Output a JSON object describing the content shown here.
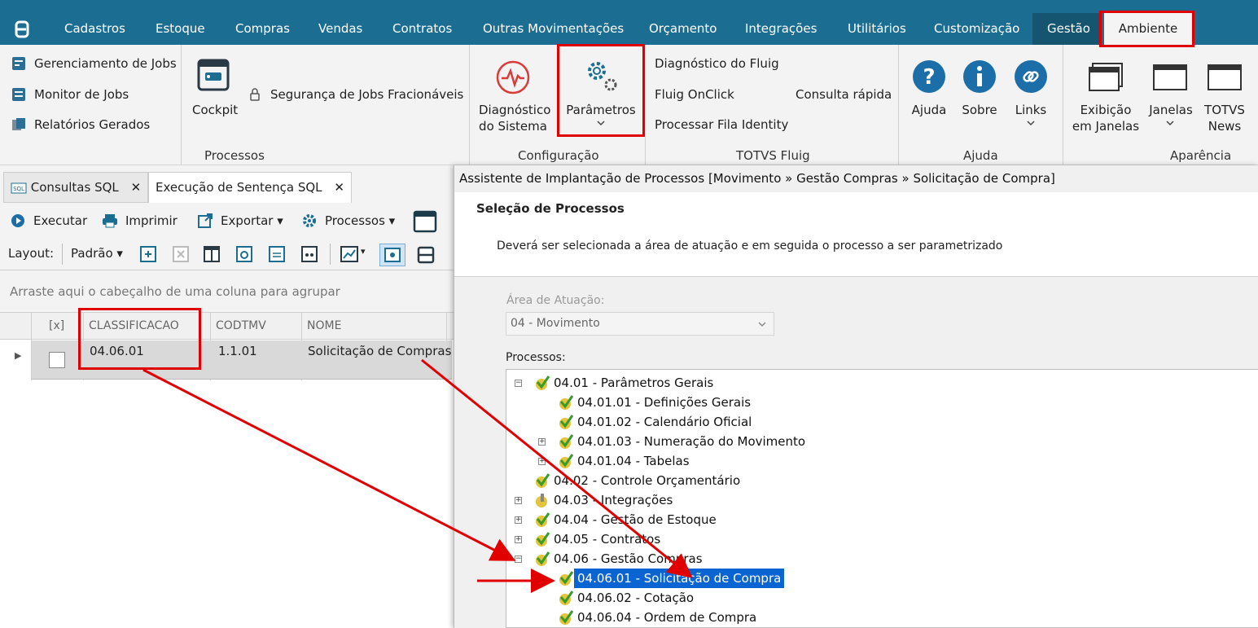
{
  "menu": {
    "items": [
      "Cadastros",
      "Estoque",
      "Compras",
      "Vendas",
      "Contratos",
      "Outras Movimentações",
      "Orçamento",
      "Integrações",
      "Utilitários",
      "Customização",
      "Gestão",
      "Ambiente"
    ]
  },
  "ribbon": {
    "processos": {
      "jobs_manager": "Gerenciamento de Jobs",
      "jobs_monitor": "Monitor de Jobs",
      "reports": "Relatórios Gerados",
      "cockpit": "Cockpit",
      "security": "Segurança de Jobs Fracionáveis",
      "group": "Processos"
    },
    "configuracao": {
      "diag1": "Diagnóstico",
      "diag2": "do Sistema",
      "params": "Parâmetros",
      "group": "Configuração"
    },
    "fluig": {
      "diag": "Diagnóstico do Fluig",
      "onclick": "Fluig OnClick",
      "quick": "Consulta rápida",
      "identity": "Processar Fila Identity",
      "group": "TOTVS Fluig"
    },
    "ajuda": {
      "help": "Ajuda",
      "about": "Sobre",
      "links": "Links",
      "group": "Ajuda"
    },
    "aparencia": {
      "exib1": "Exibição",
      "exib2": "em Janelas",
      "janelas": "Janelas",
      "news1": "TOTVS",
      "news2": "News",
      "group": "Aparência"
    }
  },
  "tabs": {
    "sql": "Consultas SQL",
    "exec": "Execução de Sentença SQL"
  },
  "toolbar": {
    "run": "Executar",
    "print": "Imprimir",
    "export": "Exportar",
    "processes": "Processos",
    "layout": "Layout:",
    "layout_value": "Padrão"
  },
  "grid": {
    "group_hint": "Arraste aqui o cabeçalho de uma coluna para agrupar",
    "columns": [
      "[x]",
      "CLASSIFICACAO",
      "CODTMV",
      "NOME"
    ],
    "row": {
      "classificacao": "04.06.01",
      "codtmv": "1.1.01",
      "nome": "Solicitação de Compras"
    }
  },
  "dialog": {
    "title": "Assistente de Implantação de Processos [Movimento » Gestão Compras » Solicitação de Compra]",
    "heading": "Seleção de Processos",
    "description": "Deverá ser selecionada a área de atuação e em seguida o processo a ser parametrizado",
    "area_label": "Área de Atuação:",
    "area_value": "04 - Movimento",
    "processes_label": "Processos:",
    "tree": [
      "04.01 - Parâmetros Gerais",
      "04.01.01 - Definições Gerais",
      "04.01.02 - Calendário Oficial",
      "04.01.03 - Numeração do Movimento",
      "04.01.04 - Tabelas",
      "04.02 - Controle Orçamentário",
      "04.03 - Integrações",
      "04.04 - Gestão de Estoque",
      "04.05 - Contratos",
      "04.06 - Gestão Compras",
      "04.06.01 - Solicitação de Compra",
      "04.06.02 - Cotação",
      "04.06.04 - Ordem de Compra"
    ]
  },
  "colors": {
    "menubar": "#1b6e92",
    "highlight": "#e00000",
    "selection": "#0a64d2"
  }
}
